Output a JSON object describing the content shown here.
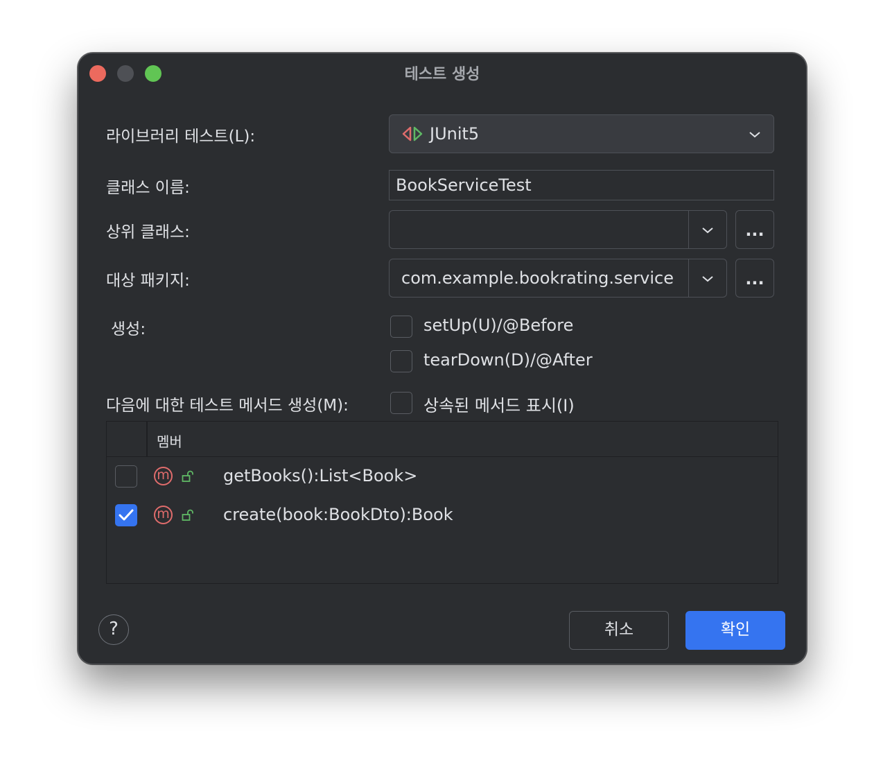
{
  "window": {
    "title": "테스트 생성"
  },
  "form": {
    "library_label": "라이브러리 테스트(L):",
    "library_value": "JUnit5",
    "library_icon": "junit-icon",
    "class_name_label": "클래스 이름:",
    "class_name_value": "BookServiceTest",
    "superclass_label": "상위 클래스:",
    "superclass_value": "",
    "package_label": "대상 패키지:",
    "package_value": "com.example.bookrating.service",
    "browse_label": "...",
    "generate_label": "생성:",
    "setup_label": "setUp(U)/@Before",
    "setup_checked": false,
    "teardown_label": "tearDown(D)/@After",
    "teardown_checked": false,
    "methods_label": "다음에 대한 테스트 메서드 생성(M):",
    "show_inherited_label": "상속된 메서드 표시(I)",
    "show_inherited_checked": false
  },
  "members_table": {
    "column_header": "멤버",
    "rows": [
      {
        "checked": false,
        "icon": "method-icon",
        "icon_text": "m",
        "visibility_icon": "public-lock-icon",
        "signature": "getBooks():List<Book>"
      },
      {
        "checked": true,
        "icon": "method-icon",
        "icon_text": "m",
        "visibility_icon": "public-lock-icon",
        "signature": "create(book:BookDto):Book"
      }
    ]
  },
  "footer": {
    "help_label": "?",
    "cancel_label": "취소",
    "ok_label": "확인"
  },
  "colors": {
    "background": "#2b2d30",
    "accent": "#3574f0",
    "method_icon": "#e06c6c",
    "junit_left": "#e06c6c",
    "junit_right": "#5fb865"
  }
}
